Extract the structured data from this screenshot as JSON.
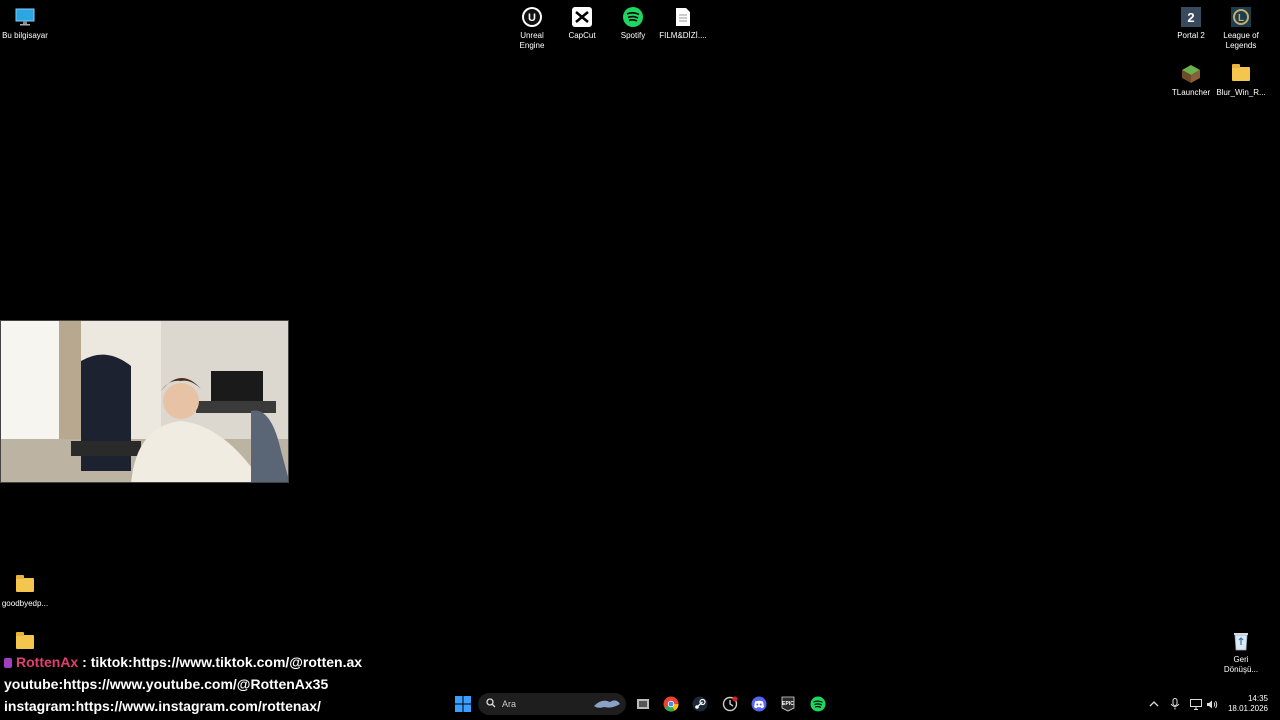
{
  "desktop": {
    "top_left": [
      {
        "label": "Bu bilgisayar",
        "icon": "monitor-icon"
      }
    ],
    "top_center": [
      {
        "label": "Unreal Engine",
        "icon": "unreal-engine-icon"
      },
      {
        "label": "CapCut",
        "icon": "capcut-icon"
      },
      {
        "label": "Spotify",
        "icon": "spotify-icon"
      },
      {
        "label": "FILM&DİZİ....",
        "icon": "text-file-icon"
      }
    ],
    "top_right": [
      {
        "label": "Portal 2",
        "icon": "portal2-icon"
      },
      {
        "label": "League of Legends",
        "icon": "league-of-legends-icon"
      },
      {
        "label": "TLauncher",
        "icon": "tlauncher-icon"
      },
      {
        "label": "Blur_Win_R...",
        "icon": "folder-icon"
      }
    ],
    "bottom_left": [
      {
        "label": "goodbyedp...",
        "icon": "folder-icon"
      }
    ],
    "recycle_bin": {
      "label": "Geri Dönüşü...",
      "icon": "recycle-bin-icon"
    }
  },
  "chat_overlay": {
    "username": "RottenAx",
    "separator": " : ",
    "line1": "tiktok:https://www.tiktok.com/@rotten.ax",
    "line2": "youtube:https://www.youtube.com/@RottenAx35",
    "line3": "instagram:https://www.instagram.com/rottenax/"
  },
  "taskbar": {
    "search_placeholder": "Ara",
    "apps": [
      "windows-start-icon",
      "task-view-icon",
      "chrome-icon",
      "steam-icon",
      "clock-app-icon",
      "discord-icon",
      "epic-games-icon",
      "spotify-icon"
    ],
    "tray_icons": [
      "chevron-up-icon",
      "microphone-icon",
      "display-icon",
      "volume-icon"
    ],
    "time": "14:35",
    "date": "18.01.2026"
  },
  "colors": {
    "desktop_bg": "#000000",
    "folder": "#f5c64e",
    "spotify": "#1ed760",
    "username": "#e04070"
  }
}
